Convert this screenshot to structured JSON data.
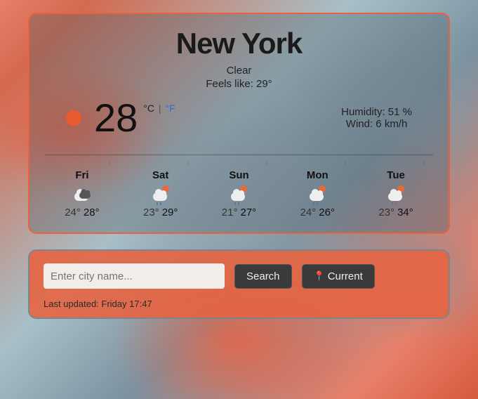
{
  "city": "New York",
  "description": "Clear",
  "feels_like_label": "Feels like: 29°",
  "temperature": "28",
  "unit_c": "°C",
  "unit_sep": " | ",
  "unit_f": "°F",
  "humidity_label": "Humidity: 51 %",
  "wind_label": "Wind: 6 km/h",
  "forecast": [
    {
      "day": "Fri",
      "lo": "24°",
      "hi": "28°",
      "icon": "cloud-dark"
    },
    {
      "day": "Sat",
      "lo": "23°",
      "hi": "29°",
      "icon": "rain-sun"
    },
    {
      "day": "Sun",
      "lo": "21°",
      "hi": "27°",
      "icon": "rain-sun"
    },
    {
      "day": "Mon",
      "lo": "24°",
      "hi": "26°",
      "icon": "rain-sun"
    },
    {
      "day": "Tue",
      "lo": "23°",
      "hi": "34°",
      "icon": "rain-sun"
    }
  ],
  "search": {
    "placeholder": "Enter city name...",
    "search_btn": "Search",
    "current_btn": "Current"
  },
  "last_updated": "Last updated: Friday 17:47"
}
